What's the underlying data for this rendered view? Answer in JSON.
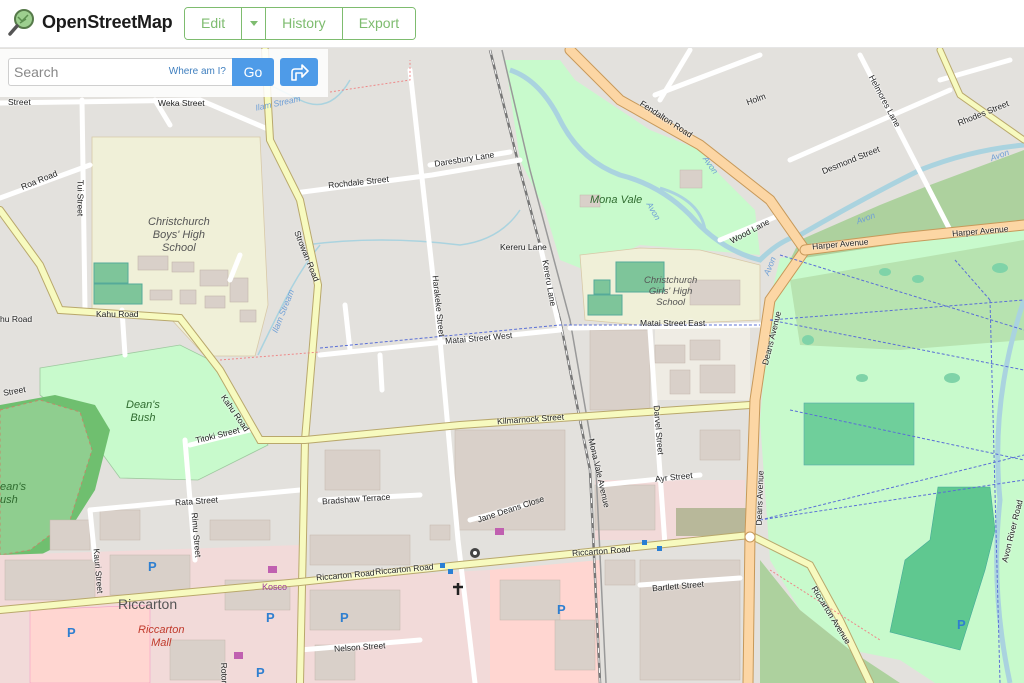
{
  "header": {
    "brand": "OpenStreetMap",
    "nav": {
      "edit": "Edit",
      "history": "History",
      "export": "Export"
    }
  },
  "search": {
    "placeholder": "Search",
    "where_am_i": "Where am I?",
    "go": "Go"
  },
  "map": {
    "streets": {
      "weka_street": "Weka Street",
      "street_tl": "Street",
      "roa_road": "Roa Road",
      "tui_street": "Tui Street",
      "strowan_road": "Strowan Road",
      "rochdale_street": "Rochdale Street",
      "daresbury_lane": "Daresbury Lane",
      "holm": "Holm",
      "rhodes_street": "Rhodes Street",
      "fendalton_road": "Fendalton Road",
      "helmores_lane": "Helmores Lane",
      "desmond_street": "Desmond Street",
      "wood_lane": "Wood Lane",
      "harper_avenue_1": "Harper Avenue",
      "harper_avenue_2": "Harper Avenue",
      "kereru_lane_1": "Kereru Lane",
      "kereru_lane_2": "Kereru Lane",
      "harakeke_street": "Harakeke Street",
      "kahu_road": "Kahu Road",
      "kahu_road_2": "Kahu Road",
      "kahu_road_left": "hu Road",
      "matai_street_west": "Matai Street West",
      "matai_street_east": "Matai Street East",
      "deans_avenue_1": "Deans Avenue",
      "deans_avenue_2": "Deans Avenue",
      "kilmarnock_street": "Kilmarnock Street",
      "titoki_street": "Titoki Street",
      "mona_vale_avenue": "Mona Vale Avenue",
      "darvel_street": "Darvel Street",
      "ayr_street": "Ayr Street",
      "rata_street": "Rata Street",
      "bradshaw_terrace": "Bradshaw Terrace",
      "jane_deans_close": "Jane Deans Close",
      "rimu_street": "Rimu Street",
      "kauri_street": "Kauri Street",
      "riccarton_road_1": "Riccarton Road",
      "riccarton_road_2": "Riccarton Road",
      "riccarton_road_3": "Riccarton Road",
      "bartlett_street": "Bartlett Street",
      "riccarton_avenue": "Riccarton Avenue",
      "avon_river_road": "Avon River Road",
      "nelson_street": "Nelson Street",
      "street_left": "Street",
      "rotor": "Rotor"
    },
    "water": {
      "ilam_stream_1": "Ilam Stream",
      "ilam_stream_2": "Ilam Stream",
      "avon_1": "Avon",
      "avon_2": "Avon",
      "avon_3": "Avon",
      "avon_4": "Avon",
      "avon_5": "Avon"
    },
    "areas": {
      "boys_high": "Christchurch\nBoys' High\nSchool",
      "girls_high": "Christchurch\nGirls' High\nSchool",
      "mona_vale": "Mona Vale",
      "deans_bush": "Dean's\nBush",
      "deans_bush_left": "ean's\nush",
      "riccarton": "Riccarton",
      "riccarton_mall": "Riccarton\nMall",
      "kosco": "Kosco"
    },
    "parking": "P",
    "colors": {
      "land": "#f2efe9",
      "residential": "#e0dfdf",
      "school": "#f0f0d8",
      "park": "#c8facc",
      "forest": "#add19e",
      "wood": "#6fbf6f",
      "pitch": "#80d7a8",
      "retail": "#ffd6d1",
      "commercial": "#f2dad9",
      "primary_road": "#fcd6a4",
      "secondary_road": "#f7fabf",
      "water": "#aad3df",
      "building": "#d9d0c9"
    }
  }
}
